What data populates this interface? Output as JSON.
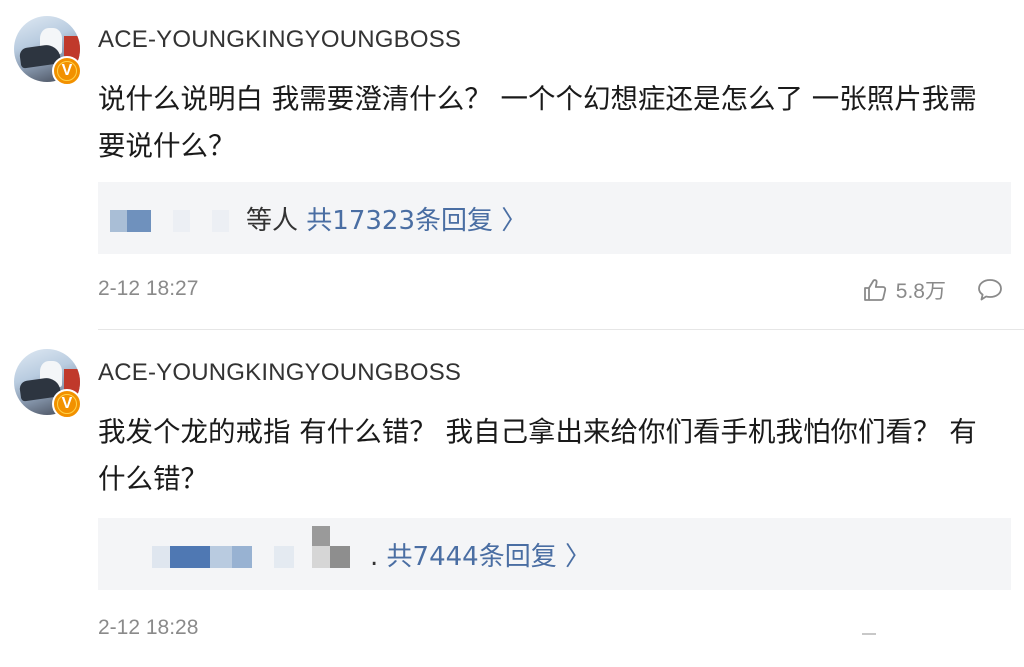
{
  "comments": [
    {
      "username": "ACE-YOUNGKINGYOUNGBOSS",
      "badge": "V",
      "text": "说什么说明白 我需要澄清什么？ 一个个幻想症还是怎么了 一张照片我需要说什么？",
      "replies": {
        "who_suffix": "等人",
        "link": "共17323条回复 〉"
      },
      "time": "2-12 18:27",
      "likes": "5.8万"
    },
    {
      "username": "ACE-YOUNGKINGYOUNGBOSS",
      "badge": "V",
      "text": "我发个龙的戒指 有什么错？ 我自己拿出来给你们看手机我怕你们看？ 有什么错？",
      "replies": {
        "who_suffix": ".",
        "link": "共7444条回复 〉"
      },
      "time": "2-12 18:28"
    }
  ],
  "icons": {
    "like": "thumbs-up-icon",
    "comment": "speech-bubble-icon",
    "verified": "verified-v-badge-icon"
  },
  "colors": {
    "link": "#4a6ea3",
    "badge": "#f29100",
    "meta": "#8a8a8a",
    "reply_bg": "#f4f5f7"
  }
}
